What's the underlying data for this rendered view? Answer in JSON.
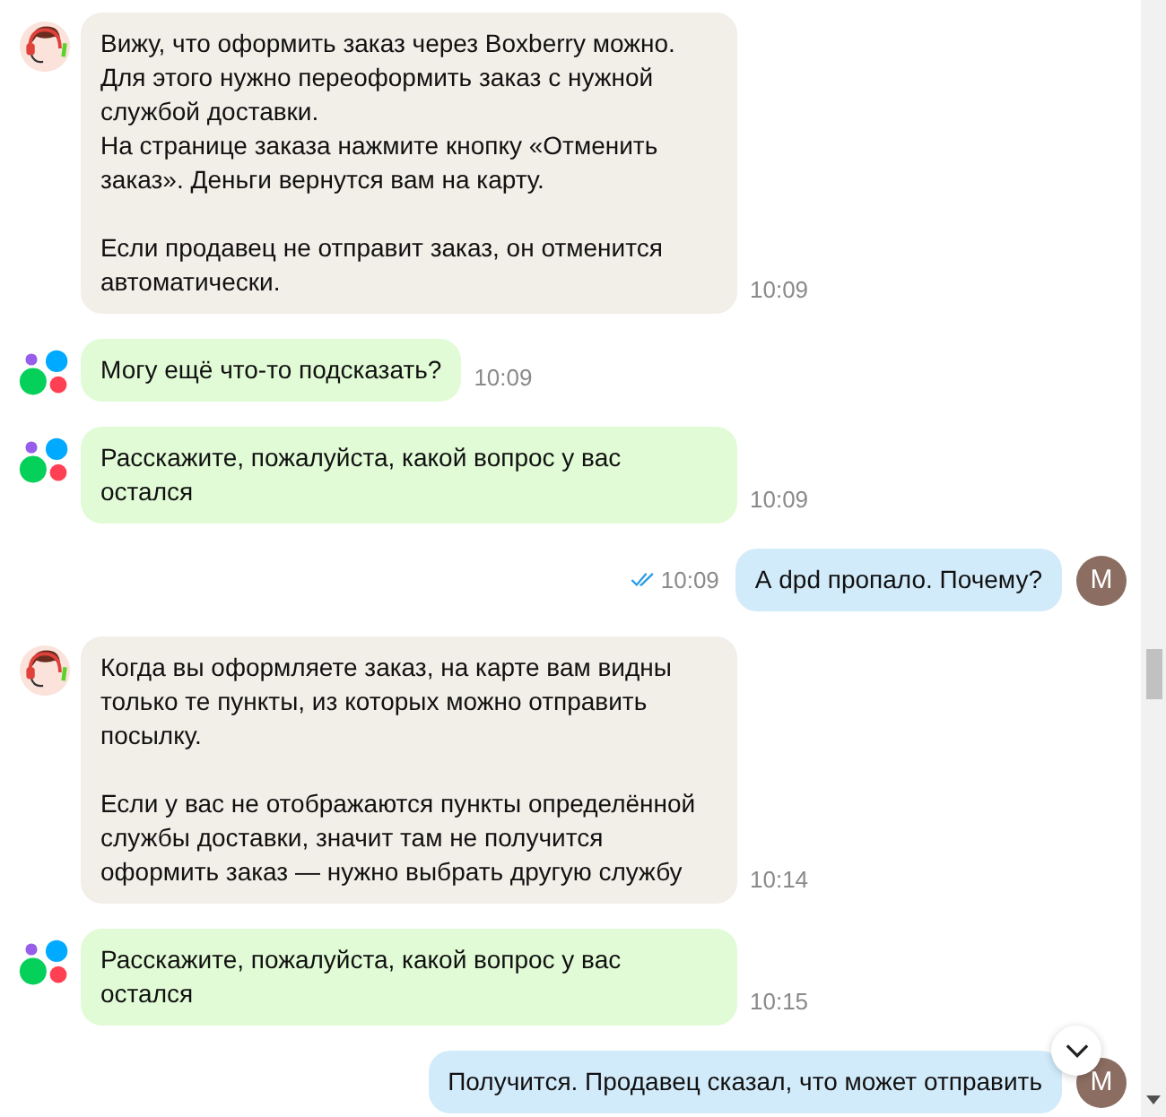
{
  "messages": [
    {
      "kind": "support",
      "text": "Вижу, что оформить заказ через Boxberry можно. Для этого нужно переоформить заказ с нужной службой доставки.\nНа странице заказа нажмите кнопку «Отменить заказ». Деньги вернутся вам на карту.\n\nЕсли продавец не отправит заказ, он отменится автоматически.",
      "time": "10:09"
    },
    {
      "kind": "bot",
      "text": "Могу ещё что-то подсказать?",
      "time": "10:09"
    },
    {
      "kind": "bot",
      "text": "Расскажите, пожалуйста, какой вопрос у вас остался",
      "time": "10:09"
    },
    {
      "kind": "user",
      "text": "А dpd пропало. Почему?",
      "time": "10:09",
      "read": true,
      "avatar_letter": "M"
    },
    {
      "kind": "support",
      "text": "Когда вы оформляете заказ, на карте вам видны только те пункты, из которых можно отправить посылку.\n\nЕсли у вас не отображаются пункты определённой службы доставки, значит там не получится оформить заказ — нужно выбрать другую службу",
      "time": "10:14"
    },
    {
      "kind": "bot",
      "text": "Расскажите, пожалуйста, какой вопрос у вас остался",
      "time": "10:15"
    },
    {
      "kind": "user",
      "text": "Получится. Продавец сказал, что может отправить",
      "avatar_letter": "M"
    }
  ]
}
